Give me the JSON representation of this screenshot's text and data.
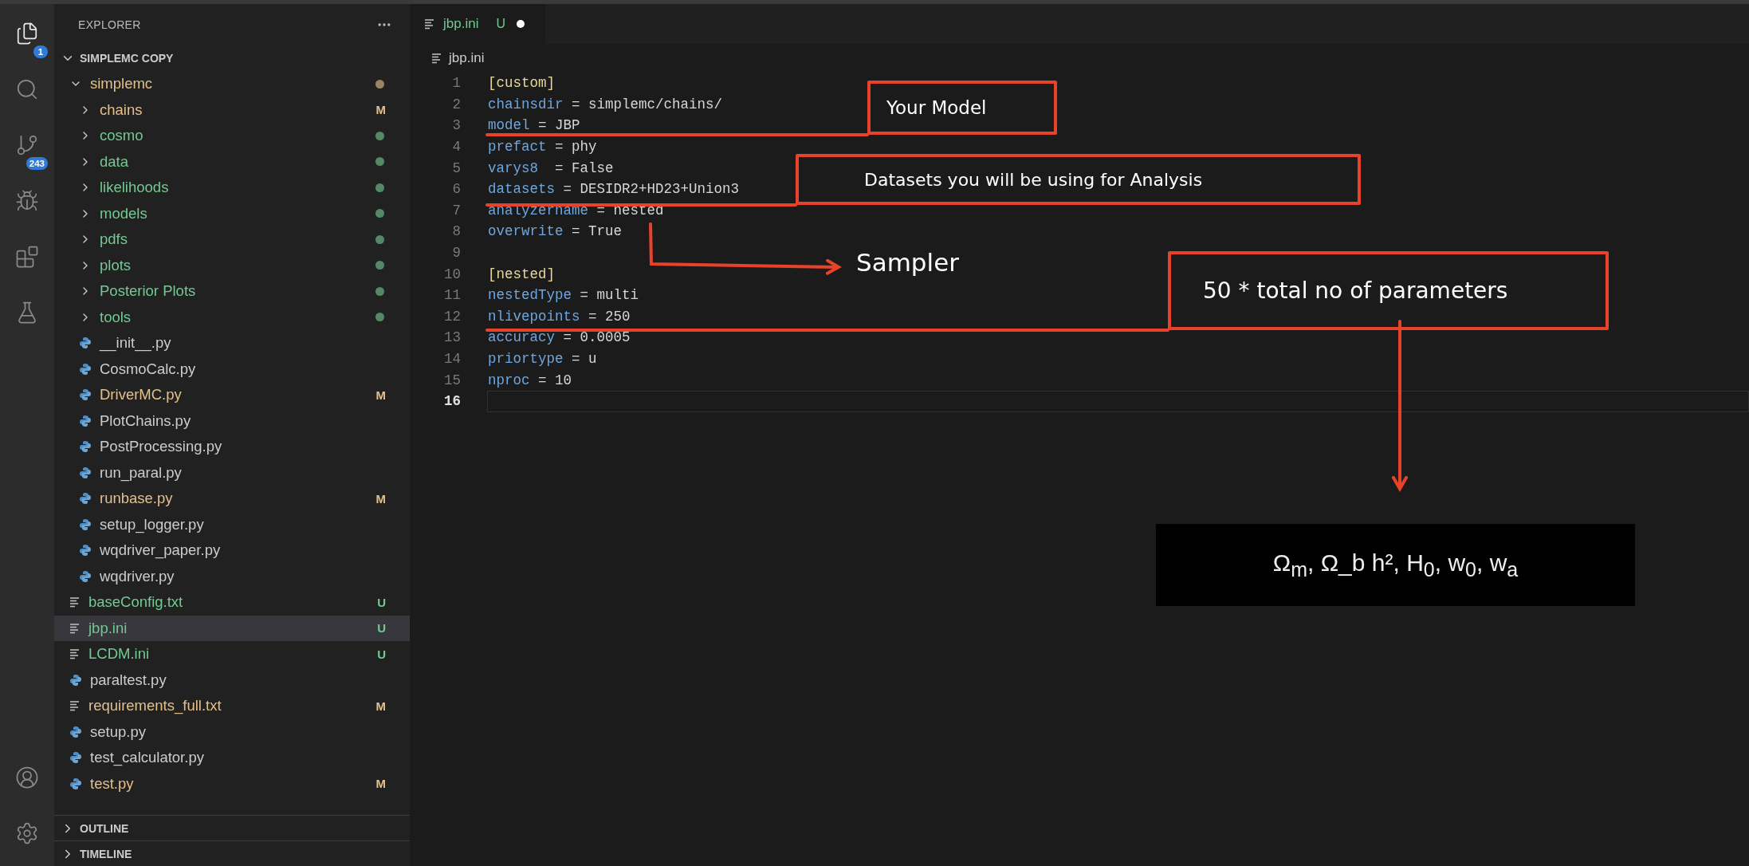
{
  "activity_bar": {
    "items": [
      {
        "kind": "explorer",
        "badge": "1",
        "selected": true
      },
      {
        "kind": "search",
        "selected": false
      },
      {
        "kind": "source-control",
        "badge": "243",
        "selected": false
      },
      {
        "kind": "run-debug",
        "selected": false
      },
      {
        "kind": "extensions",
        "selected": false
      },
      {
        "kind": "testing",
        "selected": false
      }
    ],
    "bottom": [
      {
        "kind": "accounts"
      },
      {
        "kind": "settings"
      }
    ]
  },
  "sidebar": {
    "title": "EXPLORER",
    "section": {
      "label": "SIMPLEMC COPY",
      "expanded": true
    },
    "tree": [
      {
        "name": "simplemc",
        "kind": "folder",
        "expanded": true,
        "color": "#e2c08d",
        "dot": true,
        "selected": false,
        "children": [
          {
            "name": "chains",
            "kind": "folder",
            "expanded": false,
            "color": "#e2c08d",
            "badge": "M",
            "dot": false,
            "selected": false
          },
          {
            "name": "cosmo",
            "kind": "folder",
            "expanded": false,
            "color": "#73c991",
            "dot": true,
            "selected": false
          },
          {
            "name": "data",
            "kind": "folder",
            "expanded": false,
            "color": "#73c991",
            "dot": true,
            "selected": false
          },
          {
            "name": "likelihoods",
            "kind": "folder",
            "expanded": false,
            "color": "#73c991",
            "dot": true,
            "selected": false
          },
          {
            "name": "models",
            "kind": "folder",
            "expanded": false,
            "color": "#73c991",
            "dot": true,
            "selected": false
          },
          {
            "name": "pdfs",
            "kind": "folder",
            "expanded": false,
            "color": "#73c991",
            "dot": true,
            "selected": false
          },
          {
            "name": "plots",
            "kind": "folder",
            "expanded": false,
            "color": "#73c991",
            "dot": true,
            "selected": false
          },
          {
            "name": "Posterior Plots",
            "kind": "folder",
            "expanded": false,
            "color": "#73c991",
            "dot": true,
            "selected": false
          },
          {
            "name": "tools",
            "kind": "folder",
            "expanded": false,
            "color": "#73c991",
            "dot": true,
            "selected": false
          },
          {
            "name": "__init__.py",
            "kind": "python",
            "color": "#cccccc",
            "dot": false,
            "selected": false
          },
          {
            "name": "CosmoCalc.py",
            "kind": "python",
            "color": "#cccccc",
            "dot": false,
            "selected": false
          },
          {
            "name": "DriverMC.py",
            "kind": "python",
            "color": "#e2c08d",
            "badge": "M",
            "dot": false,
            "selected": false
          },
          {
            "name": "PlotChains.py",
            "kind": "python",
            "color": "#cccccc",
            "dot": false,
            "selected": false
          },
          {
            "name": "PostProcessing.py",
            "kind": "python",
            "color": "#cccccc",
            "dot": false,
            "selected": false
          },
          {
            "name": "run_paral.py",
            "kind": "python",
            "color": "#cccccc",
            "dot": false,
            "selected": false
          },
          {
            "name": "runbase.py",
            "kind": "python",
            "color": "#e2c08d",
            "badge": "M",
            "dot": false,
            "selected": false
          },
          {
            "name": "setup_logger.py",
            "kind": "python",
            "color": "#cccccc",
            "dot": false,
            "selected": false
          },
          {
            "name": "wqdriver_paper.py",
            "kind": "python",
            "color": "#cccccc",
            "dot": false,
            "selected": false
          },
          {
            "name": "wqdriver.py",
            "kind": "python",
            "color": "#cccccc",
            "dot": false,
            "selected": false
          }
        ]
      },
      {
        "name": "baseConfig.txt",
        "kind": "text",
        "color": "#73c991",
        "badge": "U",
        "dot": false,
        "selected": false
      },
      {
        "name": "jbp.ini",
        "kind": "text",
        "color": "#73c991",
        "badge": "U",
        "dot": false,
        "selected": true
      },
      {
        "name": "LCDM.ini",
        "kind": "text",
        "color": "#73c991",
        "badge": "U",
        "dot": false,
        "selected": false
      },
      {
        "name": "paraltest.py",
        "kind": "python",
        "color": "#cccccc",
        "dot": false,
        "selected": false
      },
      {
        "name": "requirements_full.txt",
        "kind": "text",
        "color": "#e2c08d",
        "badge": "M",
        "dot": false,
        "selected": false
      },
      {
        "name": "setup.py",
        "kind": "python",
        "color": "#cccccc",
        "dot": false,
        "selected": false
      },
      {
        "name": "test_calculator.py",
        "kind": "python",
        "color": "#cccccc",
        "dot": false,
        "selected": false
      },
      {
        "name": "test.py",
        "kind": "python",
        "color": "#e2c08d",
        "badge": "M",
        "dot": false,
        "selected": false
      }
    ],
    "panels": [
      {
        "label": "OUTLINE",
        "expanded": false
      },
      {
        "label": "TIMELINE",
        "expanded": false
      }
    ]
  },
  "editor": {
    "tabs": [
      {
        "label": "jbp.ini",
        "status": "U",
        "dirty": true,
        "selected": true
      }
    ],
    "breadcrumb": "jbp.ini",
    "lines": [
      {
        "number": "1",
        "kind": "section",
        "text": "[custom]",
        "current": false
      },
      {
        "number": "2",
        "kind": "pair",
        "key": "chainsdir",
        "value": "= simplemc/chains/",
        "current": false
      },
      {
        "number": "3",
        "kind": "pair",
        "key": "model",
        "value": "= JBP",
        "current": false
      },
      {
        "number": "4",
        "kind": "pair",
        "key": "prefact",
        "value": "= phy",
        "current": false
      },
      {
        "number": "5",
        "kind": "pair",
        "key": "varys8",
        "value": " = False",
        "current": false
      },
      {
        "number": "6",
        "kind": "pair",
        "key": "datasets",
        "value": "= DESIDR2+HD23+Union3",
        "current": false
      },
      {
        "number": "7",
        "kind": "pair",
        "key": "analyzername",
        "value": "= nested",
        "current": false
      },
      {
        "number": "8",
        "kind": "pair",
        "key": "overwrite",
        "value": "= True",
        "current": false
      },
      {
        "number": "9",
        "kind": "blank",
        "current": false
      },
      {
        "number": "10",
        "kind": "section",
        "text": "[nested]",
        "current": false
      },
      {
        "number": "11",
        "kind": "pair",
        "key": "nestedType",
        "value": "= multi",
        "current": false
      },
      {
        "number": "12",
        "kind": "pair",
        "key": "nlivepoints",
        "value": "= 250",
        "current": false
      },
      {
        "number": "13",
        "kind": "pair",
        "key": "accuracy",
        "value": "= 0.0005",
        "current": false
      },
      {
        "number": "14",
        "kind": "pair",
        "key": "priortype",
        "value": "= u",
        "current": false
      },
      {
        "number": "15",
        "kind": "pair",
        "key": "nproc",
        "value": "= 10",
        "current": false
      },
      {
        "number": "16",
        "kind": "blank",
        "current": true
      }
    ]
  },
  "annotations": [
    {
      "kind": "box",
      "text": "Your Model"
    },
    {
      "kind": "box",
      "text": "Datasets you will be using for Analysis"
    },
    {
      "kind": "arrow-label",
      "text": "Sampler"
    },
    {
      "kind": "box",
      "text": "50 * total no of parameters"
    },
    {
      "kind": "dark-box",
      "text": "Ω$_{m}$, Ω_b h², H$_{0}$, w$_{0}$, w$_{a}$"
    }
  ]
}
